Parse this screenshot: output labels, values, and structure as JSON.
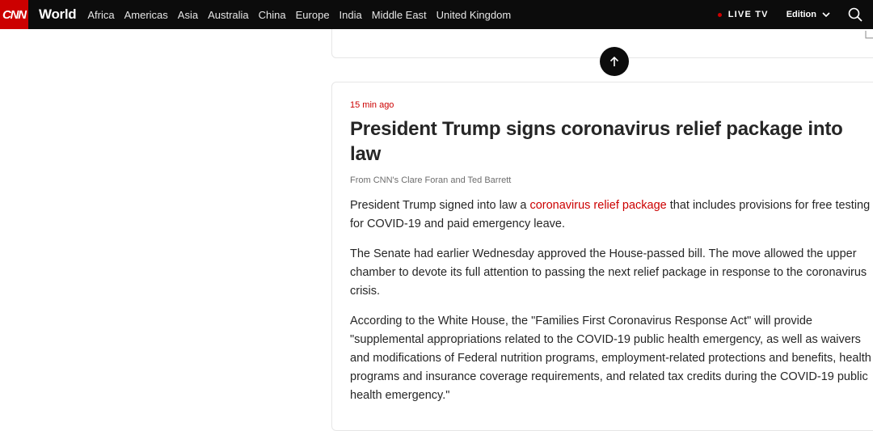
{
  "header": {
    "logo_text": "CNN",
    "section_title": "World",
    "nav_items": [
      "Africa",
      "Americas",
      "Asia",
      "Australia",
      "China",
      "Europe",
      "India",
      "Middle East",
      "United Kingdom"
    ],
    "live_label": "LIVE TV",
    "edition_label": "Edition"
  },
  "post": {
    "timestamp": "15 min ago",
    "headline": "President Trump signs coronavirus relief package into law",
    "byline": "From CNN's Clare Foran and Ted Barrett",
    "p1_before": "President Trump signed into law a ",
    "p1_link": "coronavirus relief package",
    "p1_after": " that includes provisions for free testing for COVID-19 and paid emergency leave.",
    "p2": "The Senate had earlier Wednesday approved the House-passed bill. The move allowed the upper chamber to devote its full attention to passing the next relief package in response to the coronavirus crisis.",
    "p3": "According to the White House, the \"Families First Coronavirus Response Act\" will provide \"supplemental appropriations related to the COVID-19 public health emergency, as well as waivers and modifications of Federal nutrition programs, employment-related protections and benefits, health programs and insurance coverage requirements, and related tax credits during the COVID-19 public health emergency.\""
  },
  "colors": {
    "brand_red": "#cc0000",
    "nav_background": "#0c0c0c"
  },
  "icons": {
    "back_to_top": "arrow-up-icon",
    "search": "search-icon",
    "edition": "chevron-down-icon",
    "expand": "expand-icon"
  }
}
